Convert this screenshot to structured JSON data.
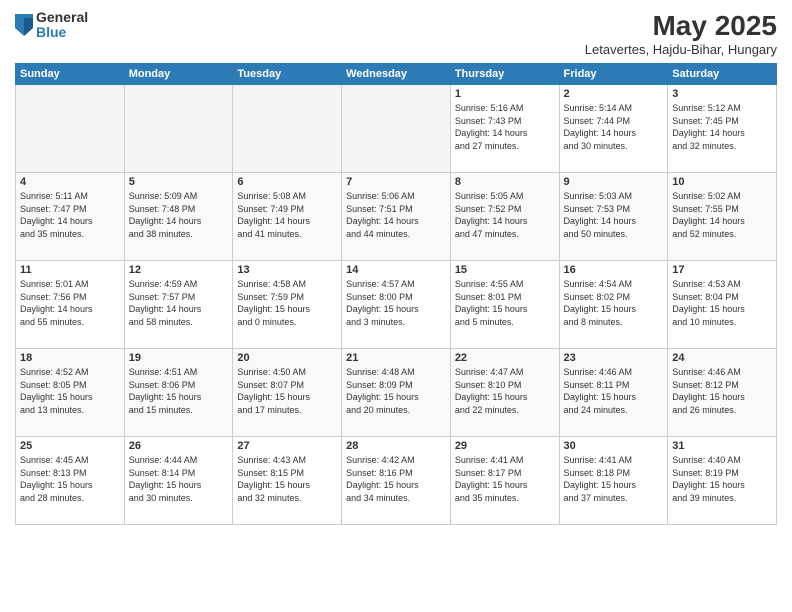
{
  "logo": {
    "general": "General",
    "blue": "Blue"
  },
  "title": "May 2025",
  "subtitle": "Letavertes, Hajdu-Bihar, Hungary",
  "days_of_week": [
    "Sunday",
    "Monday",
    "Tuesday",
    "Wednesday",
    "Thursday",
    "Friday",
    "Saturday"
  ],
  "weeks": [
    [
      {
        "day": "",
        "info": ""
      },
      {
        "day": "",
        "info": ""
      },
      {
        "day": "",
        "info": ""
      },
      {
        "day": "",
        "info": ""
      },
      {
        "day": "1",
        "info": "Sunrise: 5:16 AM\nSunset: 7:43 PM\nDaylight: 14 hours\nand 27 minutes."
      },
      {
        "day": "2",
        "info": "Sunrise: 5:14 AM\nSunset: 7:44 PM\nDaylight: 14 hours\nand 30 minutes."
      },
      {
        "day": "3",
        "info": "Sunrise: 5:12 AM\nSunset: 7:45 PM\nDaylight: 14 hours\nand 32 minutes."
      }
    ],
    [
      {
        "day": "4",
        "info": "Sunrise: 5:11 AM\nSunset: 7:47 PM\nDaylight: 14 hours\nand 35 minutes."
      },
      {
        "day": "5",
        "info": "Sunrise: 5:09 AM\nSunset: 7:48 PM\nDaylight: 14 hours\nand 38 minutes."
      },
      {
        "day": "6",
        "info": "Sunrise: 5:08 AM\nSunset: 7:49 PM\nDaylight: 14 hours\nand 41 minutes."
      },
      {
        "day": "7",
        "info": "Sunrise: 5:06 AM\nSunset: 7:51 PM\nDaylight: 14 hours\nand 44 minutes."
      },
      {
        "day": "8",
        "info": "Sunrise: 5:05 AM\nSunset: 7:52 PM\nDaylight: 14 hours\nand 47 minutes."
      },
      {
        "day": "9",
        "info": "Sunrise: 5:03 AM\nSunset: 7:53 PM\nDaylight: 14 hours\nand 50 minutes."
      },
      {
        "day": "10",
        "info": "Sunrise: 5:02 AM\nSunset: 7:55 PM\nDaylight: 14 hours\nand 52 minutes."
      }
    ],
    [
      {
        "day": "11",
        "info": "Sunrise: 5:01 AM\nSunset: 7:56 PM\nDaylight: 14 hours\nand 55 minutes."
      },
      {
        "day": "12",
        "info": "Sunrise: 4:59 AM\nSunset: 7:57 PM\nDaylight: 14 hours\nand 58 minutes."
      },
      {
        "day": "13",
        "info": "Sunrise: 4:58 AM\nSunset: 7:59 PM\nDaylight: 15 hours\nand 0 minutes."
      },
      {
        "day": "14",
        "info": "Sunrise: 4:57 AM\nSunset: 8:00 PM\nDaylight: 15 hours\nand 3 minutes."
      },
      {
        "day": "15",
        "info": "Sunrise: 4:55 AM\nSunset: 8:01 PM\nDaylight: 15 hours\nand 5 minutes."
      },
      {
        "day": "16",
        "info": "Sunrise: 4:54 AM\nSunset: 8:02 PM\nDaylight: 15 hours\nand 8 minutes."
      },
      {
        "day": "17",
        "info": "Sunrise: 4:53 AM\nSunset: 8:04 PM\nDaylight: 15 hours\nand 10 minutes."
      }
    ],
    [
      {
        "day": "18",
        "info": "Sunrise: 4:52 AM\nSunset: 8:05 PM\nDaylight: 15 hours\nand 13 minutes."
      },
      {
        "day": "19",
        "info": "Sunrise: 4:51 AM\nSunset: 8:06 PM\nDaylight: 15 hours\nand 15 minutes."
      },
      {
        "day": "20",
        "info": "Sunrise: 4:50 AM\nSunset: 8:07 PM\nDaylight: 15 hours\nand 17 minutes."
      },
      {
        "day": "21",
        "info": "Sunrise: 4:48 AM\nSunset: 8:09 PM\nDaylight: 15 hours\nand 20 minutes."
      },
      {
        "day": "22",
        "info": "Sunrise: 4:47 AM\nSunset: 8:10 PM\nDaylight: 15 hours\nand 22 minutes."
      },
      {
        "day": "23",
        "info": "Sunrise: 4:46 AM\nSunset: 8:11 PM\nDaylight: 15 hours\nand 24 minutes."
      },
      {
        "day": "24",
        "info": "Sunrise: 4:46 AM\nSunset: 8:12 PM\nDaylight: 15 hours\nand 26 minutes."
      }
    ],
    [
      {
        "day": "25",
        "info": "Sunrise: 4:45 AM\nSunset: 8:13 PM\nDaylight: 15 hours\nand 28 minutes."
      },
      {
        "day": "26",
        "info": "Sunrise: 4:44 AM\nSunset: 8:14 PM\nDaylight: 15 hours\nand 30 minutes."
      },
      {
        "day": "27",
        "info": "Sunrise: 4:43 AM\nSunset: 8:15 PM\nDaylight: 15 hours\nand 32 minutes."
      },
      {
        "day": "28",
        "info": "Sunrise: 4:42 AM\nSunset: 8:16 PM\nDaylight: 15 hours\nand 34 minutes."
      },
      {
        "day": "29",
        "info": "Sunrise: 4:41 AM\nSunset: 8:17 PM\nDaylight: 15 hours\nand 35 minutes."
      },
      {
        "day": "30",
        "info": "Sunrise: 4:41 AM\nSunset: 8:18 PM\nDaylight: 15 hours\nand 37 minutes."
      },
      {
        "day": "31",
        "info": "Sunrise: 4:40 AM\nSunset: 8:19 PM\nDaylight: 15 hours\nand 39 minutes."
      }
    ]
  ]
}
